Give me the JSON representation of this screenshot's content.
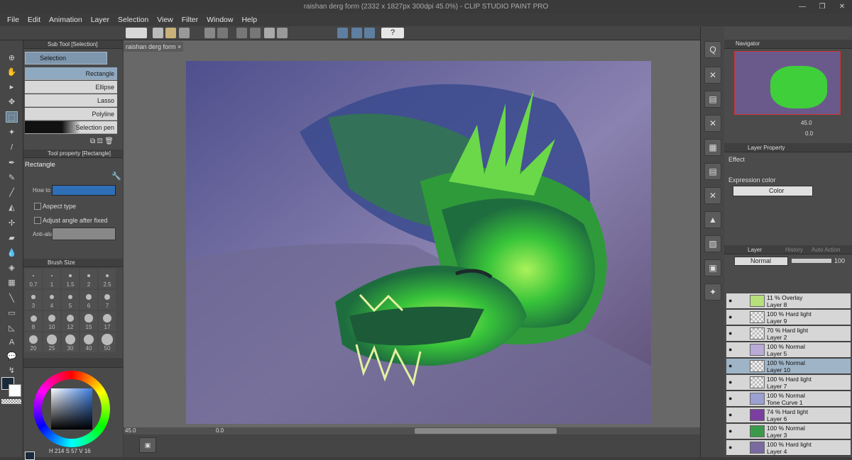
{
  "title": "raishan derg form (2332 x 1827px 300dpi 45.0%) - CLIP STUDIO PAINT PRO",
  "menu": [
    "File",
    "Edit",
    "Animation",
    "Layer",
    "Selection",
    "View",
    "Filter",
    "Window",
    "Help"
  ],
  "doc_tab": "raishan derg form",
  "subtool": {
    "title": "Sub Tool [Selection]",
    "group": "Selection",
    "items": [
      "Rectangle",
      "Ellipse",
      "Lasso",
      "Polyline",
      "Selection pen"
    ]
  },
  "toolprop": {
    "title": "Tool property [Rectangle]",
    "name": "Rectangle",
    "howto": "How to",
    "aspect": "Aspect type",
    "adjust": "Adjust angle after fixed",
    "antialias": "Anti-alia"
  },
  "brushsize": {
    "title": "Brush Size",
    "values": [
      "0.7",
      "1",
      "1.5",
      "2",
      "2.5",
      "3",
      "4",
      "5",
      "6",
      "7",
      "8",
      "10",
      "12",
      "15",
      "17",
      "20",
      "25",
      "30",
      "40",
      "50"
    ]
  },
  "color": {
    "r": "214",
    "g": "57",
    "b": "16"
  },
  "status": {
    "zoom": "45.0",
    "rot": "0.0"
  },
  "navigator": {
    "title": "Navigator",
    "zoom": "45.0",
    "angle": "0.0"
  },
  "layerprop": {
    "title": "Layer Property",
    "effect": "Effect",
    "expr": "Expression color",
    "color": "Color"
  },
  "layerpanel": {
    "tabs": [
      "Layer",
      "History",
      "Auto Action"
    ],
    "blend": "Normal",
    "opacity": "100"
  },
  "layers": [
    {
      "mode": "11 % Overlay",
      "name": "Layer 8"
    },
    {
      "mode": "100 % Hard light",
      "name": "Layer 9"
    },
    {
      "mode": "70 % Hard light",
      "name": "Layer 2"
    },
    {
      "mode": "100 % Normal",
      "name": "Layer 5"
    },
    {
      "mode": "100 % Normal",
      "name": "Layer 10"
    },
    {
      "mode": "100 % Hard light",
      "name": "Layer 7"
    },
    {
      "mode": "100 % Normal",
      "name": "Tone Curve 1"
    },
    {
      "mode": "74 % Hard light",
      "name": "Layer 6"
    },
    {
      "mode": "100 % Normal",
      "name": "Layer 3"
    },
    {
      "mode": "100 % Hard light",
      "name": "Layer 4"
    }
  ]
}
